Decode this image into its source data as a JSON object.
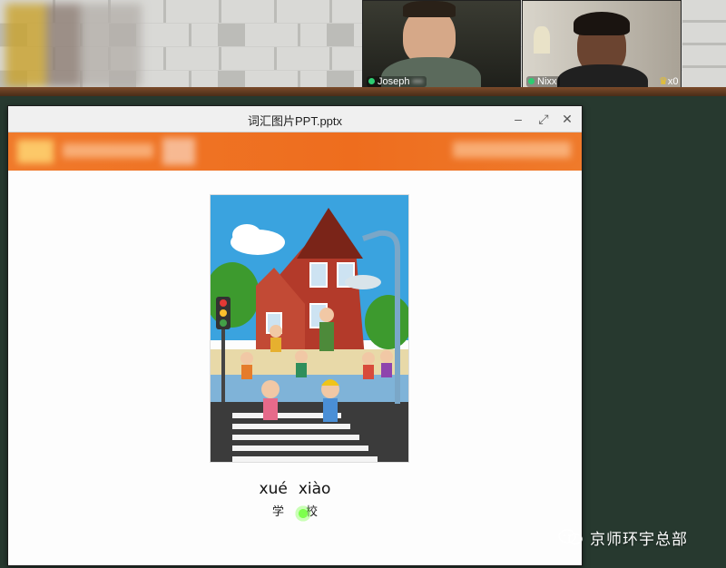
{
  "window": {
    "title": "词汇图片PPT.pptx",
    "controls": {
      "minimize": "–",
      "maximize": "⤢",
      "close": "✕"
    }
  },
  "participants": [
    {
      "name": "Joseph"
    },
    {
      "name": "Nixx"
    }
  ],
  "participant_extra": "x0",
  "slide": {
    "picture_icon": "school-scene-illustration",
    "pinyin": [
      "xué",
      "xiào"
    ],
    "hanzi": [
      "学",
      "校"
    ],
    "banner_color": "#ee6d1e"
  },
  "watermark": {
    "icon": "wechat-icon",
    "text": "京师环宇总部"
  }
}
